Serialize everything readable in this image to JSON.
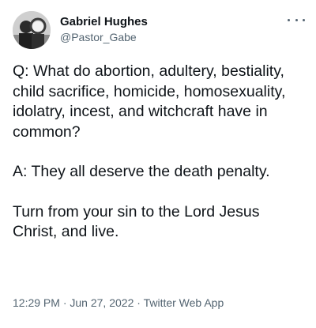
{
  "author": {
    "display_name": "Gabriel Hughes",
    "handle": "@Pastor_Gabe",
    "avatar_icon": "profile-photo"
  },
  "tweet": {
    "paragraphs": [
      "Q: What do abortion, adultery, bestiality, child sacrifice, homicide, homosexuality, idolatry, incest, and witchcraft have in common?",
      "A: They all deserve the death penalty.",
      "Turn from your sin to the Lord Jesus Christ, and live."
    ],
    "time": "12:29 PM",
    "separator": "·",
    "date": "Jun 27, 2022",
    "source": "Twitter Web App"
  },
  "icons": {
    "more": "more-options-icon"
  },
  "colors": {
    "text": "#0f1419",
    "secondary": "#536471",
    "background": "#ffffff"
  }
}
